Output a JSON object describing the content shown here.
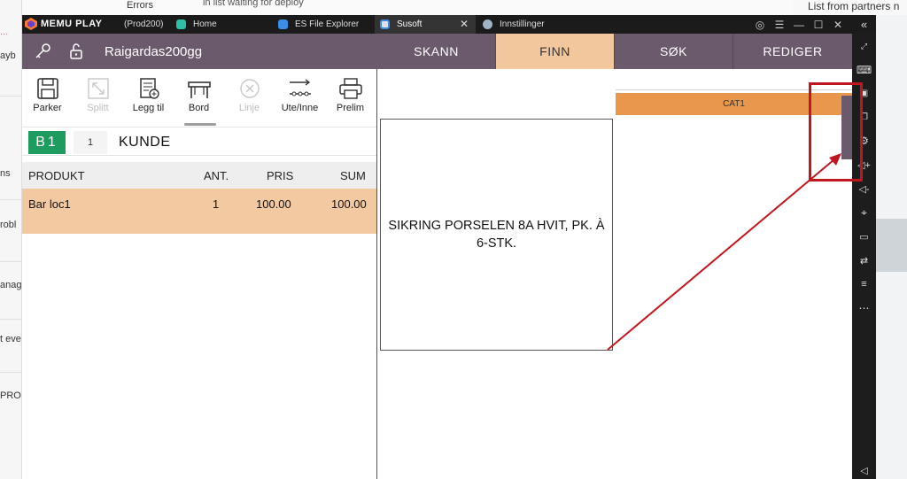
{
  "background": {
    "left_fragments": [
      "...",
      "ayb",
      "ns",
      "robl",
      "anag",
      "t eve",
      "PROE"
    ],
    "top_text": [
      "Errors",
      "in list waiting for deploy"
    ],
    "right_text": "List from partners n"
  },
  "emulator": {
    "brand": "MEMU PLAY",
    "instance": "(Prod200)",
    "tabs": [
      {
        "label": "Home",
        "icon": "home-app-icon",
        "color": "#2fbfa5"
      },
      {
        "label": "ES File Explorer",
        "icon": "folder-app-icon",
        "color": "#3a8ee6"
      },
      {
        "label": "Susoft",
        "icon": "susoft-app-icon",
        "color": "#e0e0e0"
      },
      {
        "label": "Innstillinger",
        "icon": "settings-app-icon",
        "color": "#9fb4c8"
      }
    ],
    "collapse_glyph": "«",
    "sidebar_icons": [
      "resize-icon",
      "keyboard-icon",
      "screenshot-icon",
      "multi-window-icon",
      "settings-icon",
      "volume-up-icon",
      "volume-down-icon",
      "location-icon",
      "folder-icon",
      "sync-icon",
      "list-icon",
      "more-icon",
      "back-icon"
    ]
  },
  "app": {
    "username": "Raigardas200gg",
    "nav_tabs": [
      "SKANN",
      "FINN",
      "SØK",
      "REDIGER"
    ],
    "active_nav": "FINN",
    "toolbar": [
      {
        "label": "Parker",
        "icon": "save-icon",
        "enabled": true
      },
      {
        "label": "Splitt",
        "icon": "split-icon",
        "enabled": false
      },
      {
        "label": "Legg til",
        "icon": "add-list-icon",
        "enabled": true
      },
      {
        "label": "Bord",
        "icon": "table-icon",
        "enabled": true
      },
      {
        "label": "Linje",
        "icon": "cancel-circle-icon",
        "enabled": false
      },
      {
        "label": "Ute/Inne",
        "icon": "takeaway-icon",
        "enabled": true
      },
      {
        "label": "Prelim",
        "icon": "printer-icon",
        "enabled": true
      }
    ],
    "table_badge": "B1",
    "guest_count": "1",
    "customer_label": "KUNDE",
    "columns": {
      "product": "PRODUKT",
      "qty": "ANT.",
      "price": "PRIS",
      "sum": "SUM"
    },
    "order_lines": [
      {
        "product": "Bar loc1",
        "qty": "1",
        "price": "100.00",
        "sum": "100.00"
      }
    ],
    "product_card": "SIKRING PORSELEN 8A HVIT, PK. À 6-STK.",
    "category": "CAT1",
    "colors": {
      "header": "#6b5a6c",
      "active_tab": "#f2c79d",
      "row_highlight": "#f2c9a1",
      "category": "#e8974c",
      "table_badge": "#1e9c60",
      "annotation": "#c0161f"
    }
  }
}
